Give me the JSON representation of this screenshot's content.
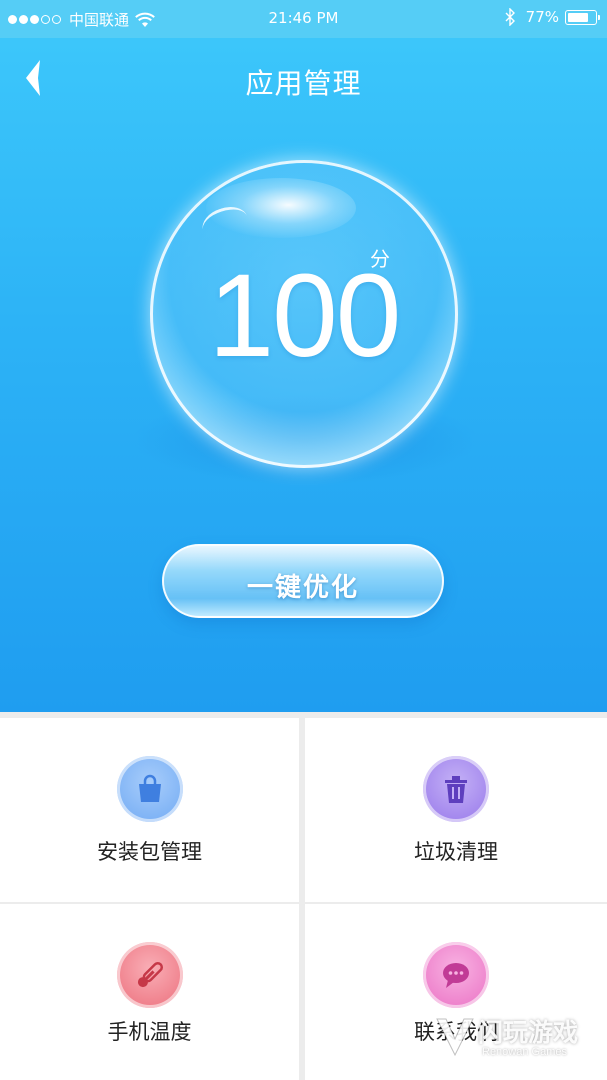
{
  "status_bar": {
    "carrier": "中国联通",
    "time": "21:46 PM",
    "battery_percent": "77%",
    "battery_level": 0.77,
    "signal_bars_filled": 3,
    "signal_bars_total": 5
  },
  "nav": {
    "back_icon": "chevron-left-icon",
    "title": "应用管理"
  },
  "score": {
    "value": "100",
    "unit": "分"
  },
  "optimize_button": {
    "label": "一键优化"
  },
  "tiles": [
    {
      "label": "安装包管理",
      "icon": "shopping-bag-icon",
      "color": "#5b9ef0"
    },
    {
      "label": "垃圾清理",
      "icon": "trash-icon",
      "color": "#8e6ae6"
    },
    {
      "label": "手机温度",
      "icon": "thermometer-icon",
      "color": "#ef6b78"
    },
    {
      "label": "联系我们",
      "icon": "chat-bubble-icon",
      "color": "#ec6fc4"
    }
  ],
  "watermark": {
    "text": "闪玩游戏",
    "subtext": "Renowan Games"
  },
  "colors": {
    "hero_top": "#3ec9fb",
    "hero_bottom": "#1f9df0",
    "status_bar": "#55cdf6",
    "grid_background": "#ececec"
  }
}
